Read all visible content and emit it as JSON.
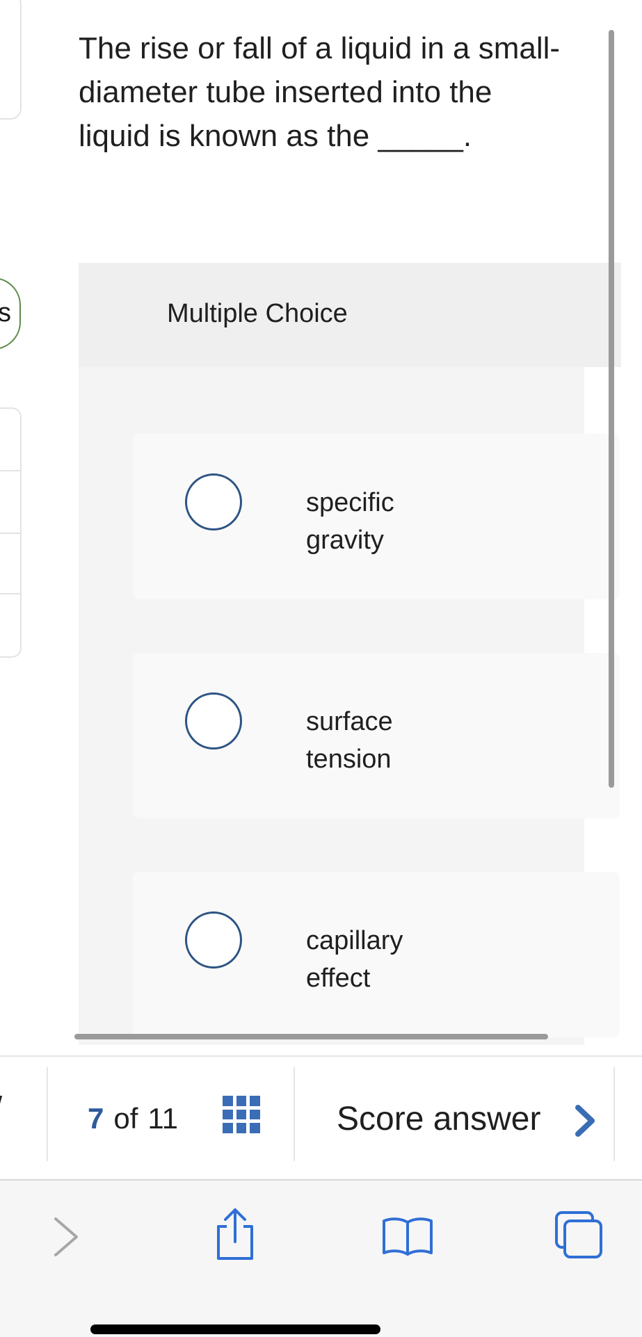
{
  "question": {
    "text": "The rise or fall of a liquid in a small-diameter tube inserted into the liquid is known as the _____."
  },
  "left_panel": {
    "pill_letter_fragment": "s"
  },
  "multiple_choice": {
    "header_label": "Multiple Choice",
    "options": [
      {
        "line1": "specific",
        "line2": "gravity",
        "selected": false
      },
      {
        "line1": "surface",
        "line2": "tension",
        "selected": false
      },
      {
        "line1": "capillary",
        "line2": "effect",
        "selected": false
      }
    ]
  },
  "quiz_bar": {
    "current_page": "7",
    "of_label": "of",
    "total_pages": "11",
    "score_label": "Score answer",
    "prev_fragment": "/"
  },
  "browser_toolbar": {
    "icons": [
      "forward-icon",
      "share-icon",
      "bookmarks-icon",
      "tabs-icon"
    ]
  },
  "colors": {
    "accent_blue": "#3a6db5",
    "radio_border": "#2d5483",
    "pill_border": "#5b8a47"
  }
}
